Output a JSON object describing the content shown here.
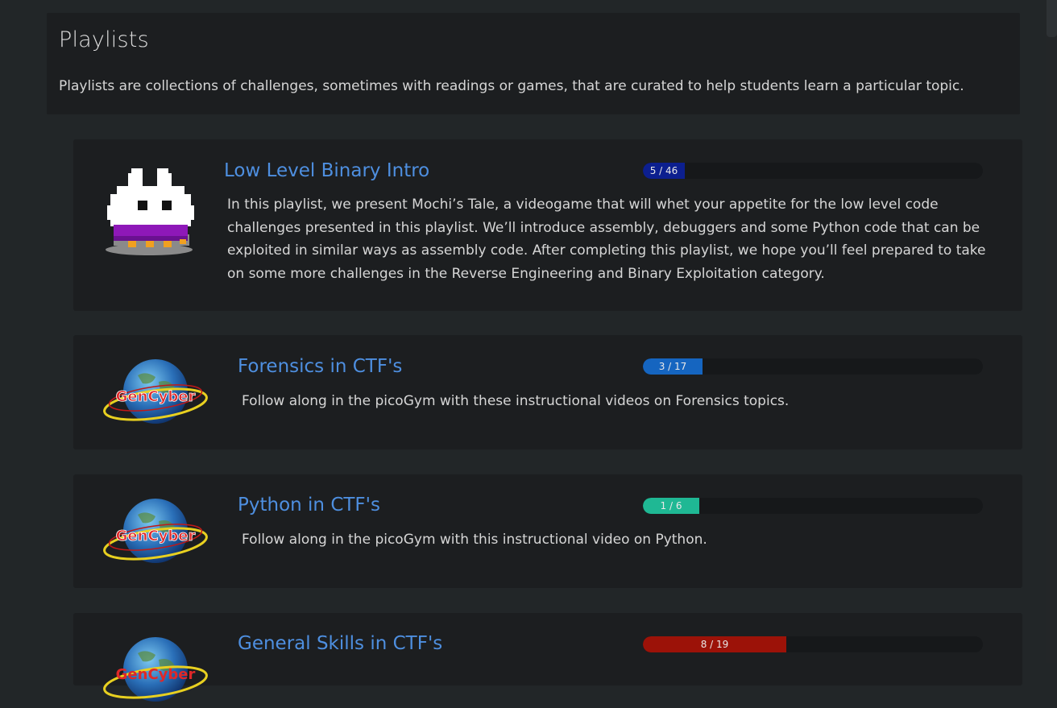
{
  "header": {
    "title": "Playlists",
    "description": "Playlists are collections of challenges, sometimes with readings or games, that are curated to help students learn a particular topic."
  },
  "playlists": [
    {
      "title": "Low Level Binary Intro",
      "description": "In this playlist, we present Mochi’s Tale, a videogame that will whet your appetite for the low level code challenges presented in this playlist. We’ll introduce assembly, debuggers and some Python code that can be exploited in similar ways as assembly code. After completing this playlist, we hope you’ll feel prepared to take on some more challenges in the Reverse Engineering and Binary Exploitation category.",
      "progress_label": "5 / 46",
      "progress_fraction": 0.1087,
      "bar_color": "#0c1f8f",
      "icon": "mochi-mascot-icon"
    },
    {
      "title": "Forensics in CTF's",
      "description": "Follow along in the picoGym with these instructional videos on Forensics topics.",
      "progress_label": "3 / 17",
      "progress_fraction": 0.1765,
      "bar_color": "#1565c0",
      "icon": "gencyber-logo-icon",
      "logo_text": "GenCyber"
    },
    {
      "title": "Python in CTF's",
      "description": "Follow along in the picoGym with this instructional video on Python.",
      "progress_label": "1 / 6",
      "progress_fraction": 0.1667,
      "bar_color": "#1fb894",
      "icon": "gencyber-logo-icon",
      "logo_text": "GenCyber"
    },
    {
      "title": "General Skills in CTF's",
      "description": "",
      "progress_label": "8 / 19",
      "progress_fraction": 0.4211,
      "bar_color": "#9c1208",
      "icon": "gencyber-logo-icon",
      "logo_text": "GenCyber"
    }
  ]
}
